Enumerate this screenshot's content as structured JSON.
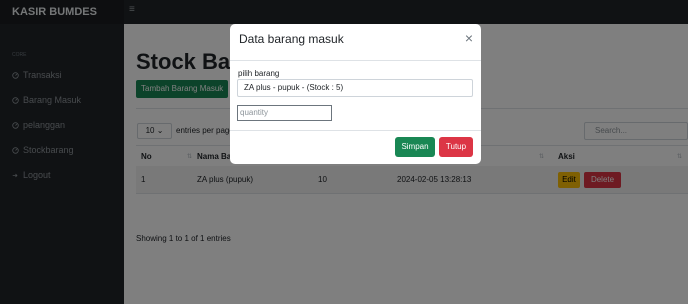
{
  "brand": "KASIR BUMDES",
  "sidebar": {
    "heading": "CORE",
    "items": [
      {
        "label": "Transaksi",
        "icon": "gauge-icon"
      },
      {
        "label": "Barang Masuk",
        "icon": "gauge-icon"
      },
      {
        "label": "pelanggan",
        "icon": "gauge-icon"
      },
      {
        "label": "Stockbarang",
        "icon": "gauge-icon"
      },
      {
        "label": "Logout",
        "icon": "logout-icon"
      }
    ]
  },
  "main": {
    "title": "Stock Barang",
    "add_button": "Tambah Barang Masuk",
    "entries_value": "10",
    "entries_label": "entries per page",
    "search_placeholder": "Search...",
    "table": {
      "headers": [
        "No",
        "Nama Barang",
        "",
        "",
        "Aksi"
      ],
      "rows": [
        {
          "no": "1",
          "nama": "ZA plus (pupuk)",
          "qty": "10",
          "tanggal": "2024-02-05 13:28:13"
        }
      ]
    },
    "edit_label": "Edit",
    "delete_label": "Delete",
    "info": "Showing 1 to 1 of 1 entries"
  },
  "modal": {
    "title": "Data barang masuk",
    "field_label": "pilih barang",
    "select_value": "ZA plus - pupuk - (Stock : 5)",
    "quantity_placeholder": "quantity",
    "save_label": "Simpan",
    "close_label": "Tutup"
  },
  "colors": {
    "success": "#198754",
    "danger": "#dc3545",
    "warning": "#ffc107",
    "sidebar": "#212529"
  }
}
